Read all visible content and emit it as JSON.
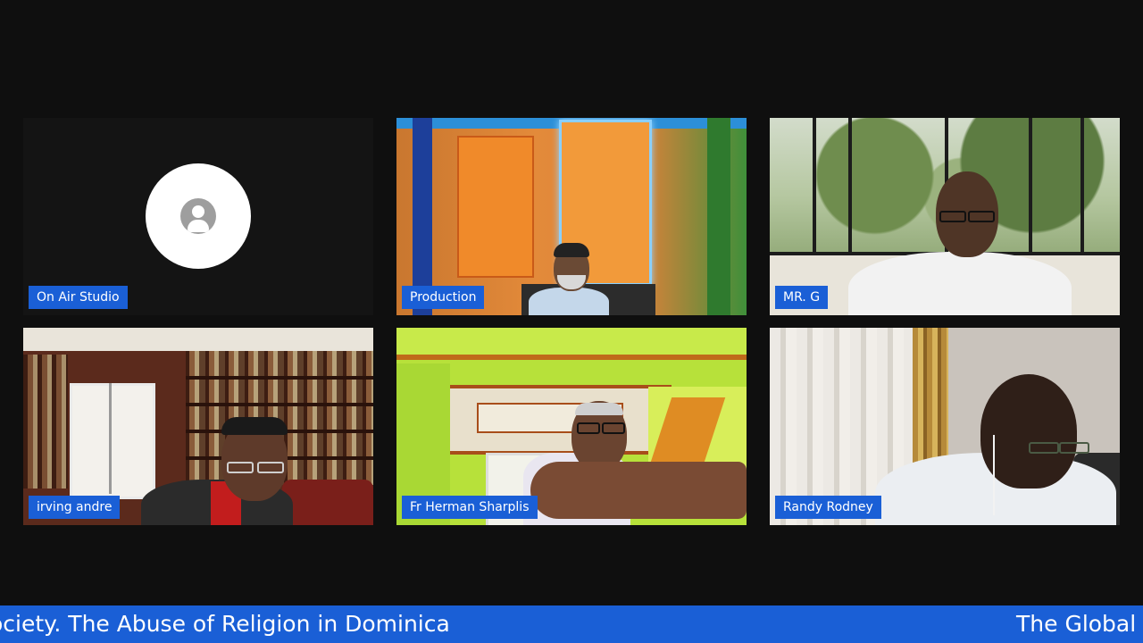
{
  "participants": [
    {
      "name": "On Air Studio",
      "video": false
    },
    {
      "name": "Production",
      "video": true
    },
    {
      "name": "MR. G",
      "video": true
    },
    {
      "name": "irving andre",
      "video": true
    },
    {
      "name": "Fr Herman Sharplis",
      "video": true
    },
    {
      "name": "Randy Rodney",
      "video": true
    }
  ],
  "ticker": {
    "segment_1": "ociety. The Abuse of Religion in Dominica",
    "segment_2": "The Global V"
  },
  "colors": {
    "background": "#0f0f0f",
    "accent": "#1a5fd6"
  },
  "icons": {
    "avatar_placeholder": "account-circle-icon"
  }
}
